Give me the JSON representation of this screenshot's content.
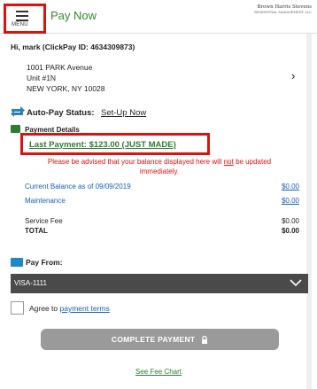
{
  "header": {
    "menu_label": "MENU",
    "title": "Pay Now",
    "brand_name": "Brown Harris Stevens",
    "brand_sub": "RESIDENTIAL MANAGEMENT, LLC"
  },
  "account": {
    "greeting": "Hi, mark (ClickPay ID: 4634309873)",
    "address_line1": "1001 PARK Avenue",
    "address_line2": "Unit #1N",
    "address_line3": "NEW YORK, NY 10028",
    "chevron": "›"
  },
  "autopay": {
    "label": "Auto-Pay Status:",
    "link": "Set-Up Now",
    "icon": "refresh-arrows-icon"
  },
  "payment_details": {
    "label": "Payment Details",
    "last_payment": "Last Payment: $123.00 (JUST MADE)",
    "notice_part1": "Please be advised that your balance displayed here will",
    "notice_not": "not",
    "notice_part2": "be updated immediately.",
    "rows": [
      {
        "label": "Current Balance as of 09/09/2019",
        "value": "$0.00"
      },
      {
        "label": "Maintenance",
        "value": "$0.00"
      },
      {
        "label": "Service Fee",
        "value": "$0.00"
      },
      {
        "label": "TOTAL",
        "value": "$0.00"
      }
    ]
  },
  "pay_from": {
    "label": "Pay From:",
    "selected": "VISA-1111",
    "icon": "wallet-icon"
  },
  "terms": {
    "prefix": "Agree to",
    "link": "payment terms"
  },
  "actions": {
    "complete_label": "COMPLETE PAYMENT",
    "fee_chart": "See Fee Chart"
  },
  "colors": {
    "brand_green": "#2e7d32",
    "link_blue": "#1a5fb4",
    "alert_red": "#dd1111",
    "select_bg": "#4a4a4a",
    "button_disabled": "#9a9a9a"
  }
}
